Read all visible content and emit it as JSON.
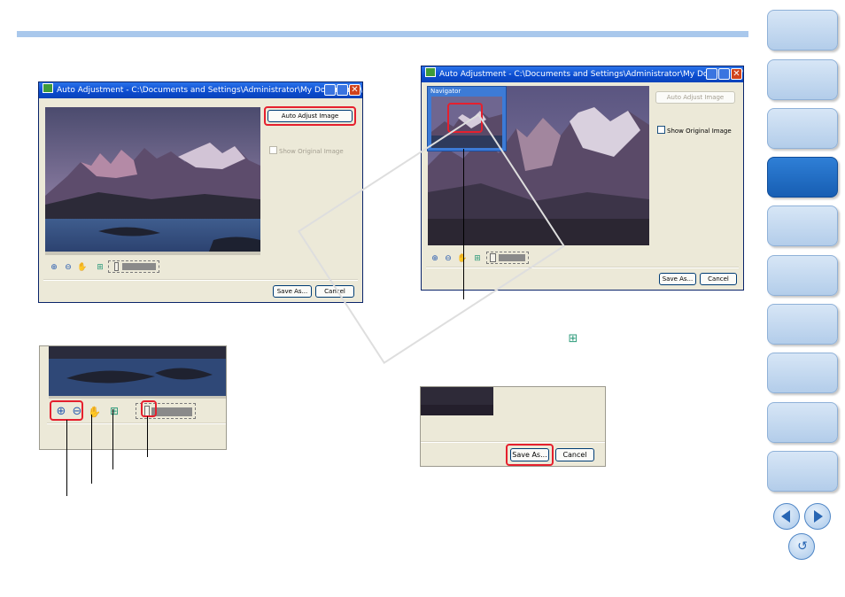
{
  "window1": {
    "title": "Auto Adjustment - C:\\Documents and Settings\\Administrator\\My Documents\\My ...",
    "auto_adjust_label": "Auto Adjust Image",
    "show_original_label": "Show Original Image",
    "save_as_label": "Save As...",
    "cancel_label": "Cancel"
  },
  "window2": {
    "title": "Auto Adjustment - C:\\Documents and Settings\\Administrator\\My Documents\\My Pictures\\...",
    "navigator_label": "Navigator",
    "auto_adjust_label": "Auto Adjust Image",
    "show_original_label": "Show Original Image",
    "save_as_label": "Save As...",
    "cancel_label": "Cancel"
  },
  "crop3": {
    "save_as_label": "Save As...",
    "cancel_label": "Cancel"
  },
  "icons": {
    "zoom_in": "zoom-in-icon",
    "zoom_out": "zoom-out-icon",
    "hand": "hand-tool-icon",
    "fit": "fit-to-window-icon"
  },
  "colors": {
    "highlight": "#e5202e",
    "nav_active": "#1a63b8",
    "nav_inactive": "#c4d9ef"
  }
}
